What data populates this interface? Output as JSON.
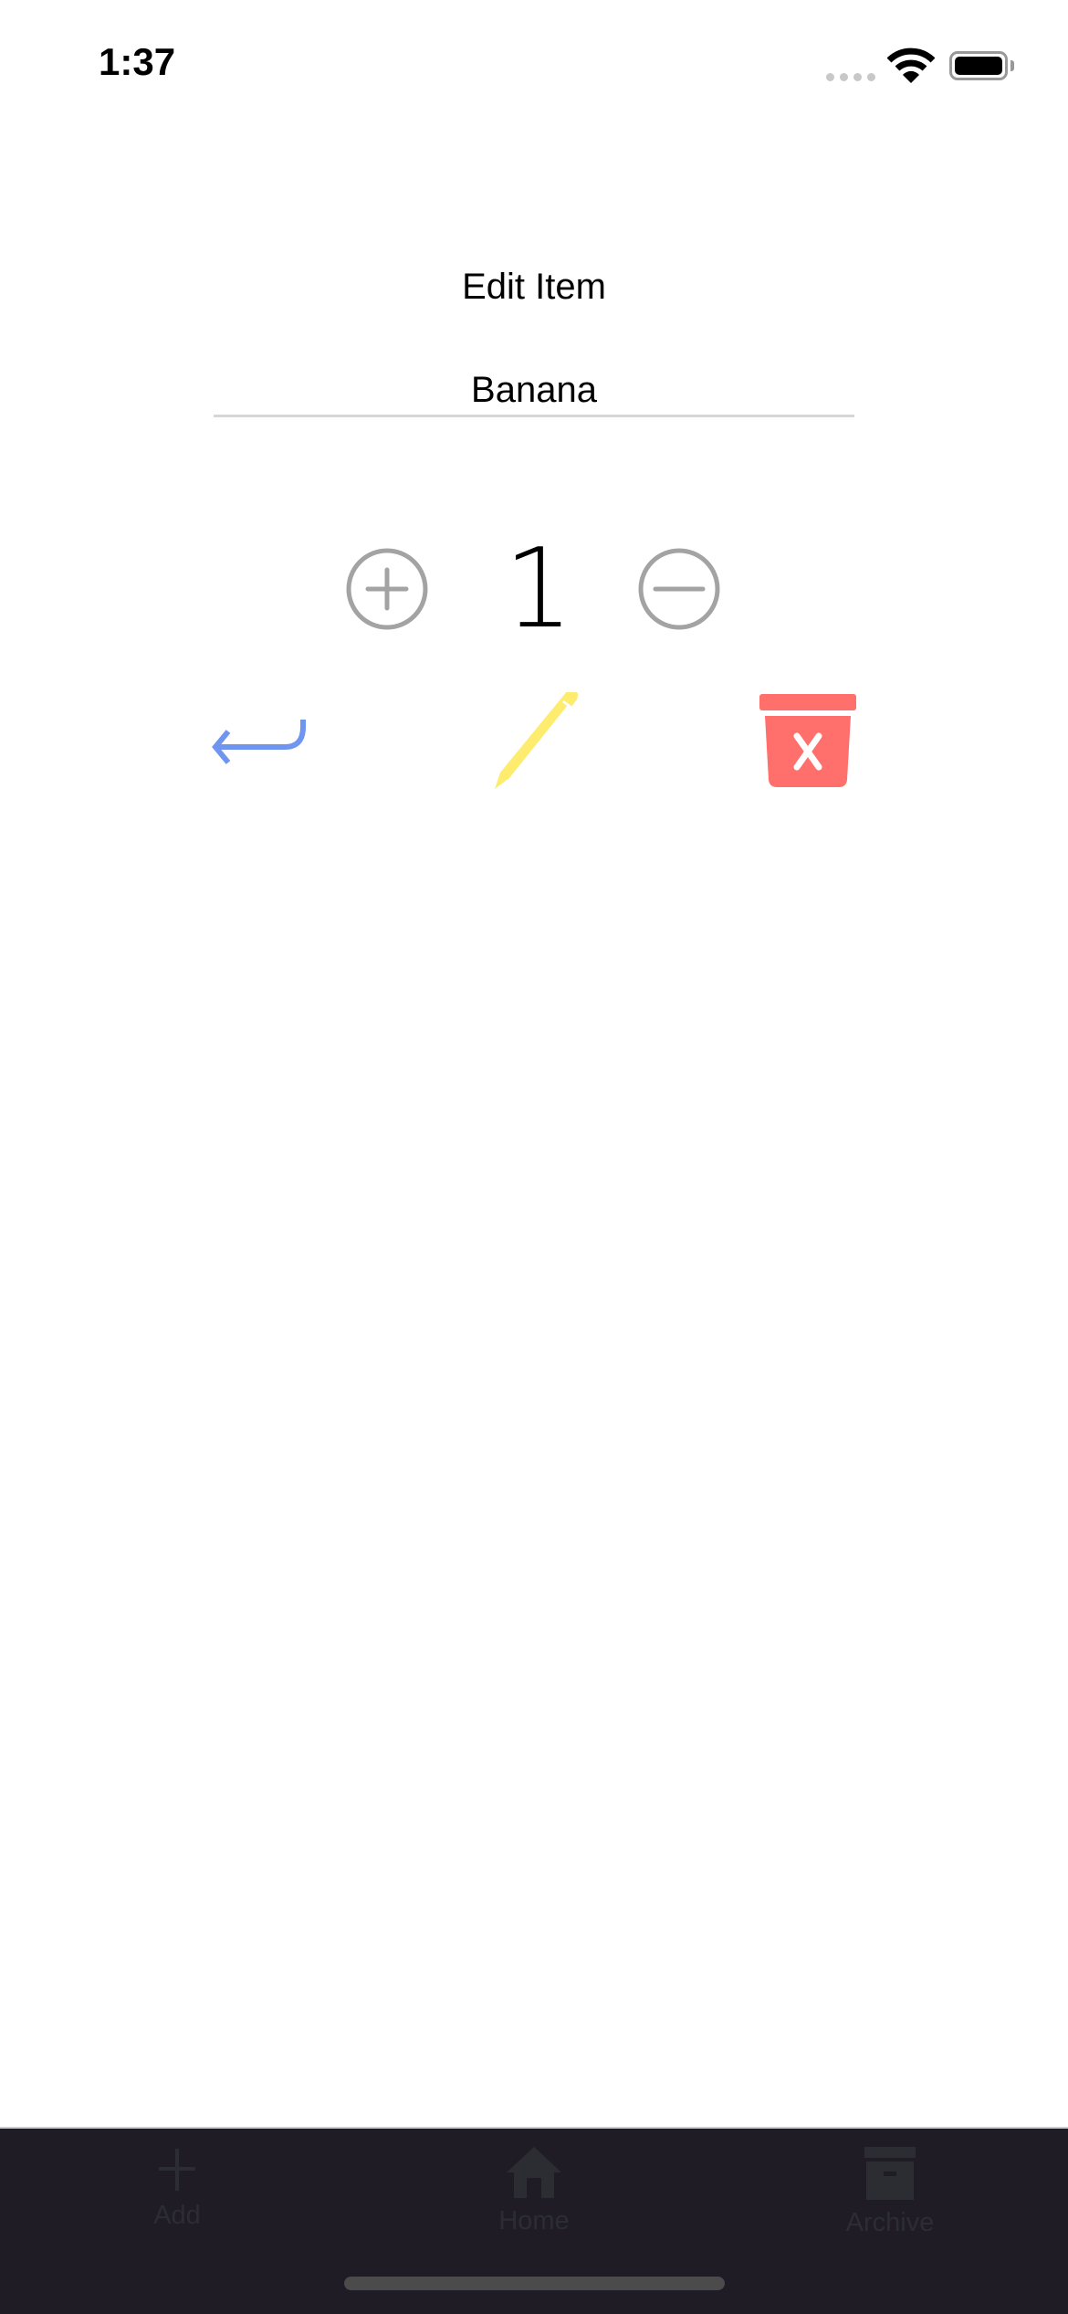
{
  "status_bar": {
    "time": "1:37",
    "signal_icon": "signal-dots-icon",
    "wifi_icon": "wifi-icon",
    "battery_icon": "battery-full-icon"
  },
  "header": {
    "title": "Edit Item"
  },
  "item": {
    "name": "Banana",
    "quantity": "1"
  },
  "stepper": {
    "increment_icon": "plus-circle-icon",
    "decrement_icon": "minus-circle-icon"
  },
  "actions": [
    {
      "icon": "return-arrow-icon",
      "color": "#6f95f1"
    },
    {
      "icon": "pencil-icon",
      "color": "#fdec6e"
    },
    {
      "icon": "trash-x-icon",
      "color": "#ff6f6c"
    }
  ],
  "tab_bar": {
    "background": "#1f1c26",
    "items": [
      {
        "label": "Add",
        "icon": "plus-icon"
      },
      {
        "label": "Home",
        "icon": "home-icon"
      },
      {
        "label": "Archive",
        "icon": "archive-box-icon"
      }
    ]
  }
}
